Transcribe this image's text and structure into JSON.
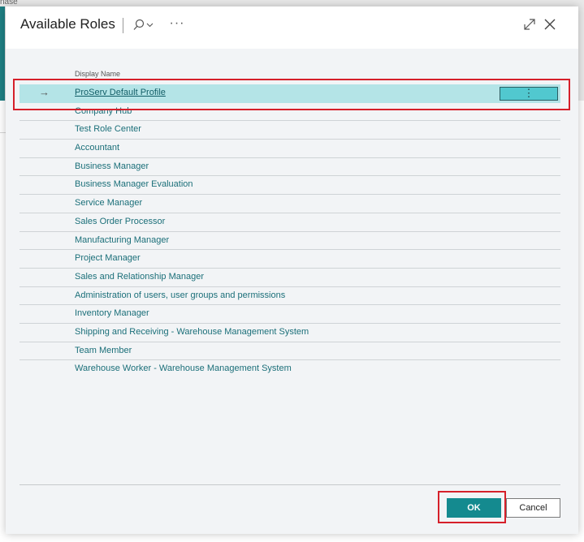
{
  "background": {
    "partial_text": "nase"
  },
  "dialog": {
    "title": "Available Roles",
    "search_icon": "search-icon",
    "more_label": "···",
    "expand_icon": "expand-icon",
    "close_icon": "close-icon"
  },
  "list": {
    "column_header": "Display Name",
    "selected_arrow": "→",
    "row_menu_label": "⋮",
    "rows": [
      {
        "label": "ProServ Default Profile"
      },
      {
        "label": "Company Hub"
      },
      {
        "label": "Test Role Center"
      },
      {
        "label": "Accountant"
      },
      {
        "label": "Business Manager"
      },
      {
        "label": "Business Manager Evaluation"
      },
      {
        "label": "Service Manager"
      },
      {
        "label": "Sales Order Processor"
      },
      {
        "label": "Manufacturing Manager"
      },
      {
        "label": "Project Manager"
      },
      {
        "label": "Sales and Relationship Manager"
      },
      {
        "label": "Administration of users, user groups and permissions"
      },
      {
        "label": "Inventory Manager"
      },
      {
        "label": "Shipping and Receiving - Warehouse Management System"
      },
      {
        "label": "Team Member"
      },
      {
        "label": "Warehouse Worker - Warehouse Management System"
      }
    ]
  },
  "footer": {
    "ok_label": "OK",
    "cancel_label": "Cancel"
  },
  "colors": {
    "accent": "#148a8f",
    "selected_row": "#b4e4e7",
    "link": "#1b6f79",
    "highlight": "#d6202a"
  }
}
